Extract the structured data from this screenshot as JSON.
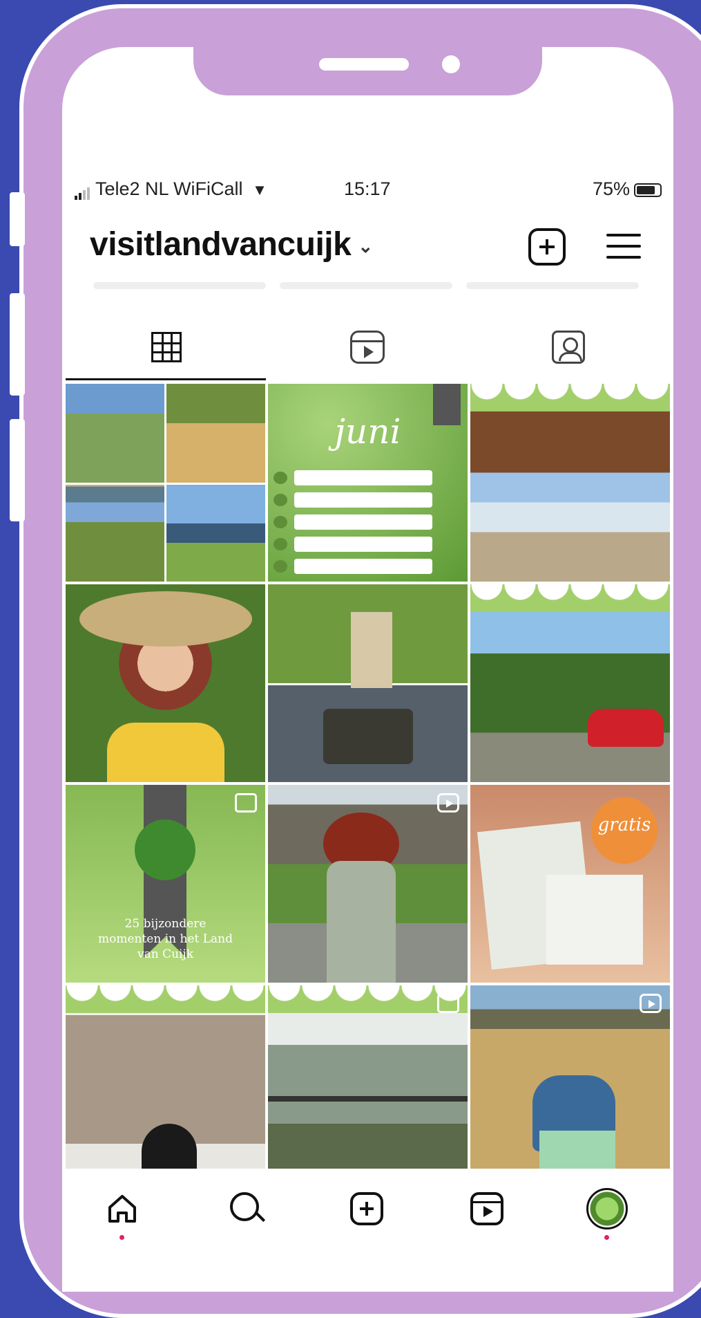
{
  "status_bar": {
    "carrier": "Tele2 NL WiFiCall",
    "time": "15:17",
    "battery": "75%"
  },
  "profile": {
    "username": "visitlandvancuijk"
  },
  "tabs": [
    {
      "icon": "grid-icon",
      "active": true
    },
    {
      "icon": "reels-icon",
      "active": false
    },
    {
      "icon": "tagged-icon",
      "active": false
    }
  ],
  "posts": {
    "juni_title": "juni",
    "zomer_text": "25 bijzondere momenten in het Land van Cuijk",
    "gratis_label": "gratis"
  },
  "bottom_nav": [
    {
      "icon": "home-icon"
    },
    {
      "icon": "search-icon"
    },
    {
      "icon": "create-icon"
    },
    {
      "icon": "reels-icon"
    },
    {
      "icon": "profile-avatar"
    }
  ],
  "colors": {
    "background": "#3a4ab0",
    "phone_frame": "#c9a0d8",
    "brand_green": "#a3cf6b",
    "notification_dot": "#e0245e"
  }
}
